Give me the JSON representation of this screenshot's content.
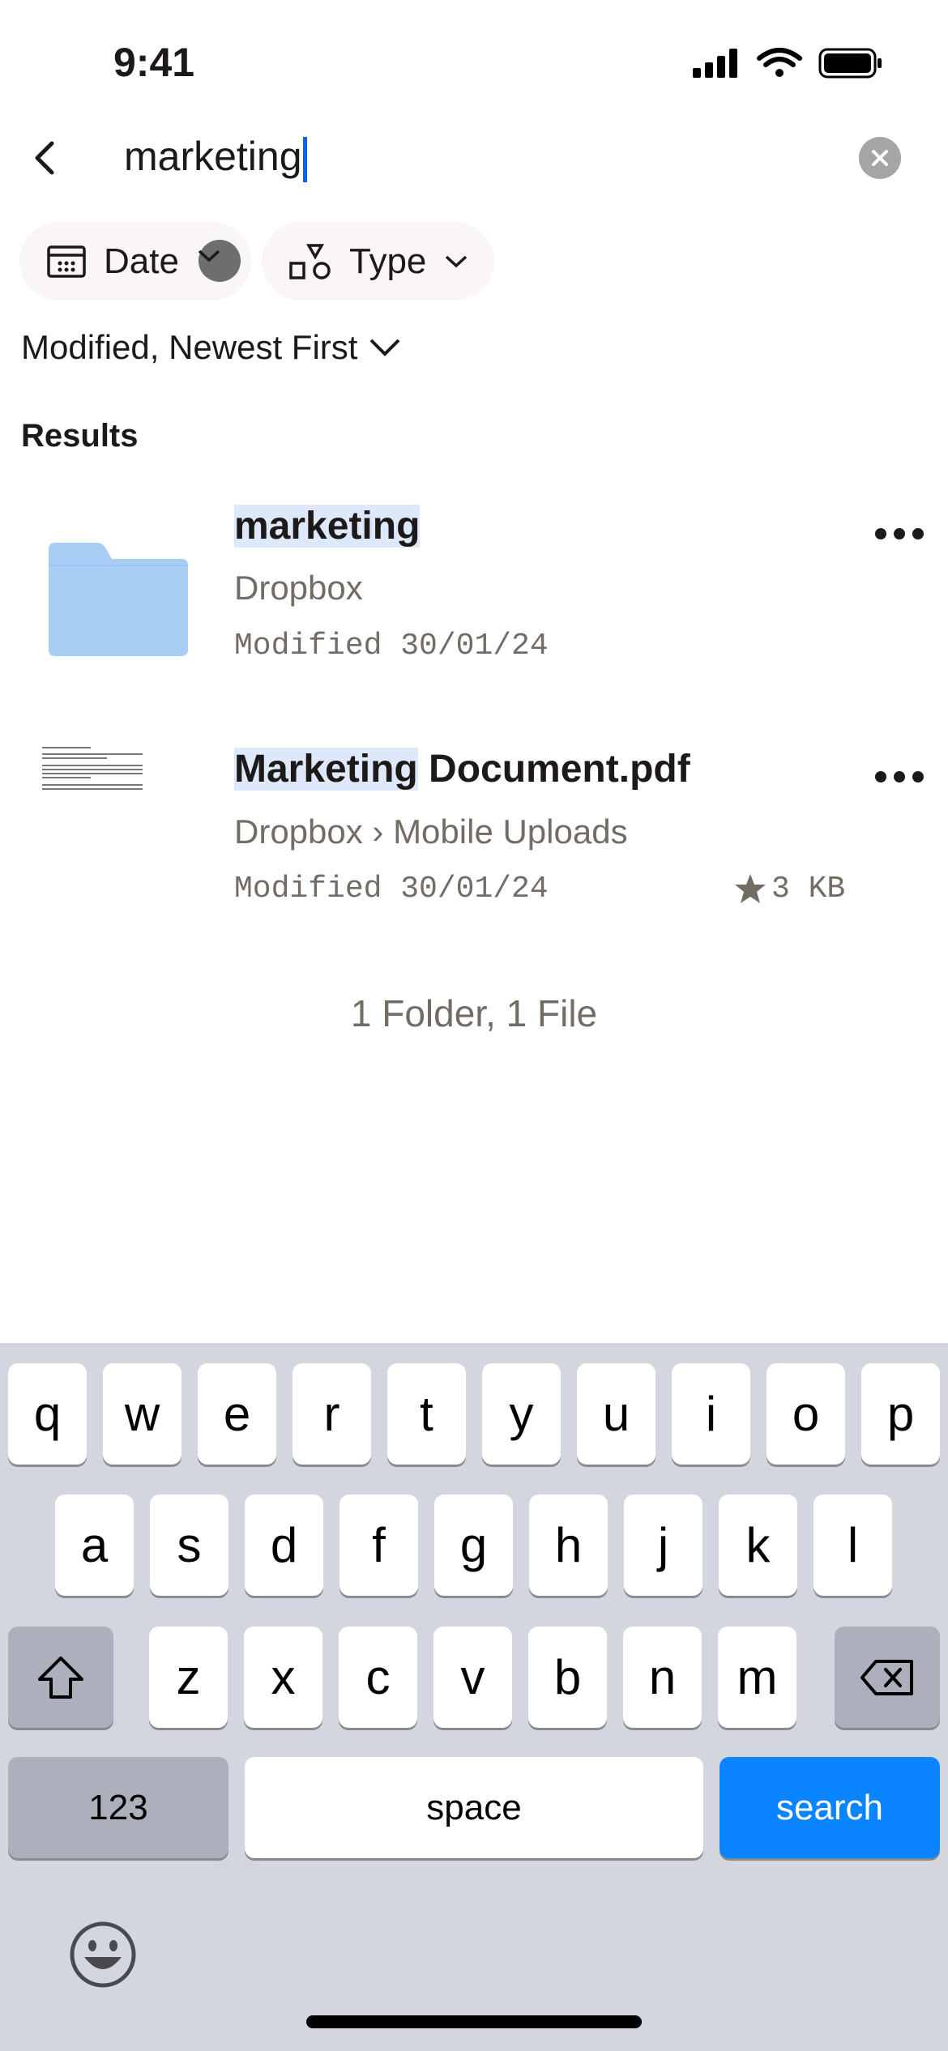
{
  "status_bar": {
    "time": "9:41"
  },
  "search": {
    "query": "marketing"
  },
  "filters": [
    {
      "label": "Date",
      "icon": "calendar-icon"
    },
    {
      "label": "Type",
      "icon": "shapes-icon"
    }
  ],
  "sort": {
    "label": "Modified, Newest First"
  },
  "results": {
    "heading": "Results",
    "items": [
      {
        "title_highlight": "marketing",
        "title_rest": "",
        "location": "Dropbox",
        "modified": "Modified 30/01/24",
        "kind": "folder",
        "folder_color": "#a8cdf5"
      },
      {
        "title_highlight": "Marketing",
        "title_rest": " Document.pdf",
        "location": "Dropbox › Mobile Uploads",
        "modified": "Modified 30/01/24",
        "size": "3 KB",
        "starred": true,
        "kind": "pdf"
      }
    ],
    "summary": "1 Folder, 1 File"
  },
  "keyboard": {
    "row1": [
      "q",
      "w",
      "e",
      "r",
      "t",
      "y",
      "u",
      "i",
      "o",
      "p"
    ],
    "row2": [
      "a",
      "s",
      "d",
      "f",
      "g",
      "h",
      "j",
      "k",
      "l"
    ],
    "row3": [
      "z",
      "x",
      "c",
      "v",
      "b",
      "n",
      "m"
    ],
    "numbers": "123",
    "space": "space",
    "search": "search",
    "accent": "#0a84ff"
  }
}
